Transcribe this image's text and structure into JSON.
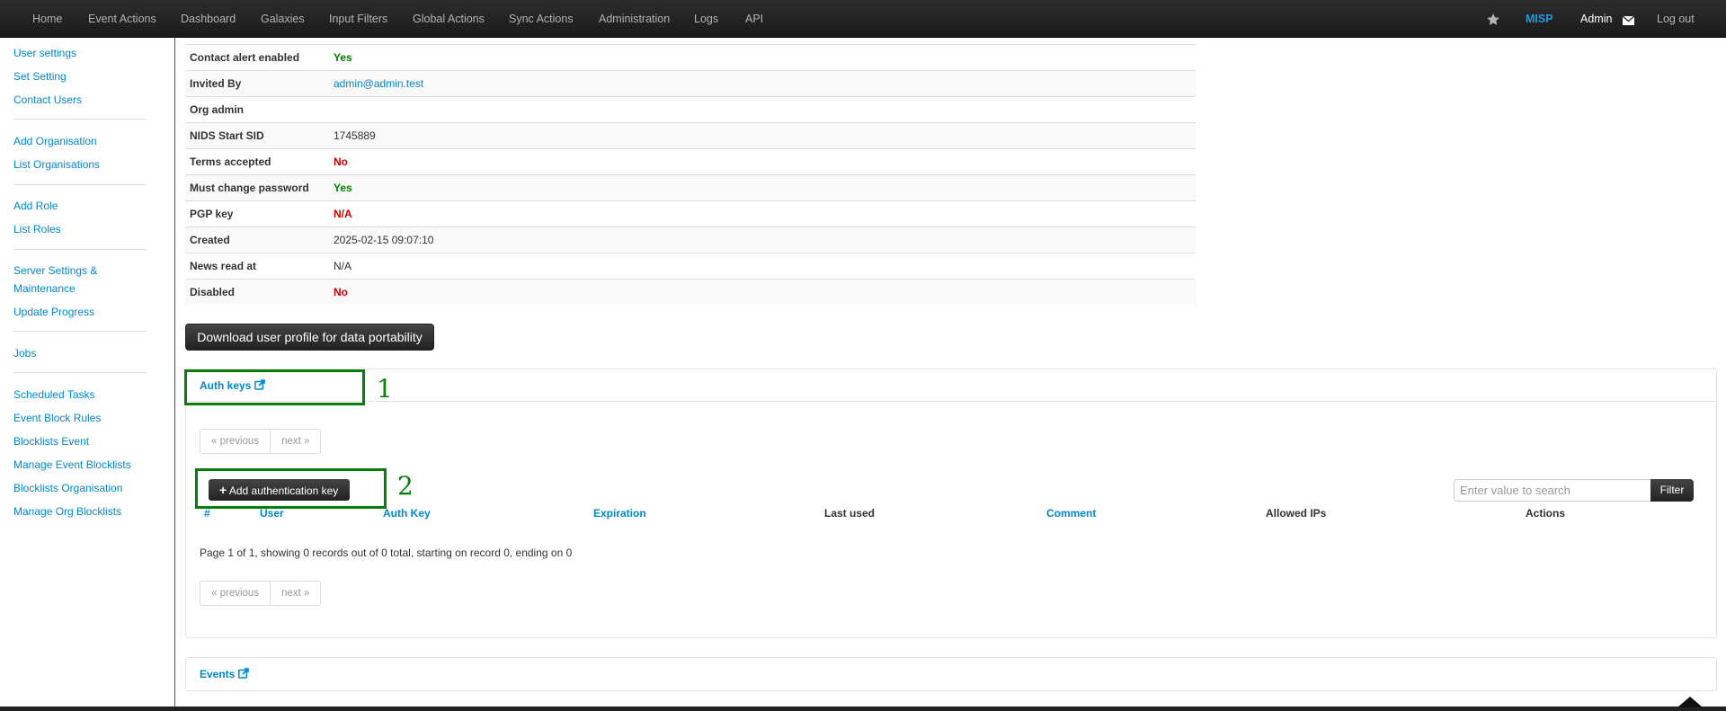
{
  "navbar": {
    "items": [
      "Home",
      "Event Actions",
      "Dashboard",
      "Galaxies",
      "Input Filters",
      "Global Actions",
      "Sync Actions",
      "Administration",
      "Logs",
      "API"
    ],
    "brand": "MISP",
    "user": "Admin",
    "logout": "Log out"
  },
  "sidebar": {
    "items": [
      "User settings",
      "Set Setting",
      "Contact Users",
      "Add Organisation",
      "List Organisations",
      "Add Role",
      "List Roles",
      "Server Settings & Maintenance",
      "Update Progress",
      "Jobs",
      "Scheduled Tasks",
      "Event Block Rules",
      "Blocklists Event",
      "Manage Event Blocklists",
      "Blocklists Organisation",
      "Manage Org Blocklists"
    ]
  },
  "details": [
    {
      "key": "Contact alert enabled",
      "value": "Yes",
      "style": "green"
    },
    {
      "key": "Invited By",
      "value": "admin@admin.test",
      "style": "link"
    },
    {
      "key": "Org admin",
      "value": "",
      "style": "plain"
    },
    {
      "key": "NIDS Start SID",
      "value": "1745889",
      "style": "plain"
    },
    {
      "key": "Terms accepted",
      "value": "No",
      "style": "red"
    },
    {
      "key": "Must change password",
      "value": "Yes",
      "style": "green"
    },
    {
      "key": "PGP key",
      "value": "N/A",
      "style": "red"
    },
    {
      "key": "Created",
      "value": "2025-02-15 09:07:10",
      "style": "plain"
    },
    {
      "key": "News read at",
      "value": "N/A",
      "style": "plain"
    },
    {
      "key": "Disabled",
      "value": "No",
      "style": "red"
    }
  ],
  "download_button": "Download user profile for data portability",
  "auth_keys": {
    "title": "Auth keys",
    "pager": {
      "previous": "« previous",
      "next": "next »"
    },
    "add_button": "Add authentication key",
    "search_placeholder": "Enter value to search",
    "filter_button": "Filter",
    "columns": [
      "#",
      "User",
      "Auth Key",
      "Expiration",
      "Last used",
      "Comment",
      "Allowed IPs",
      "Actions"
    ],
    "page_info": "Page 1 of 1, showing 0 records out of 0 total, starting on record 0, ending on 0"
  },
  "events_panel": {
    "title": "Events"
  },
  "annotations": [
    "1",
    "2"
  ],
  "colors": {
    "annotation": "#0a7d0a",
    "link": "#0088cc",
    "yes": "#008000",
    "no": "#cc0000",
    "navbar": "#222222"
  }
}
